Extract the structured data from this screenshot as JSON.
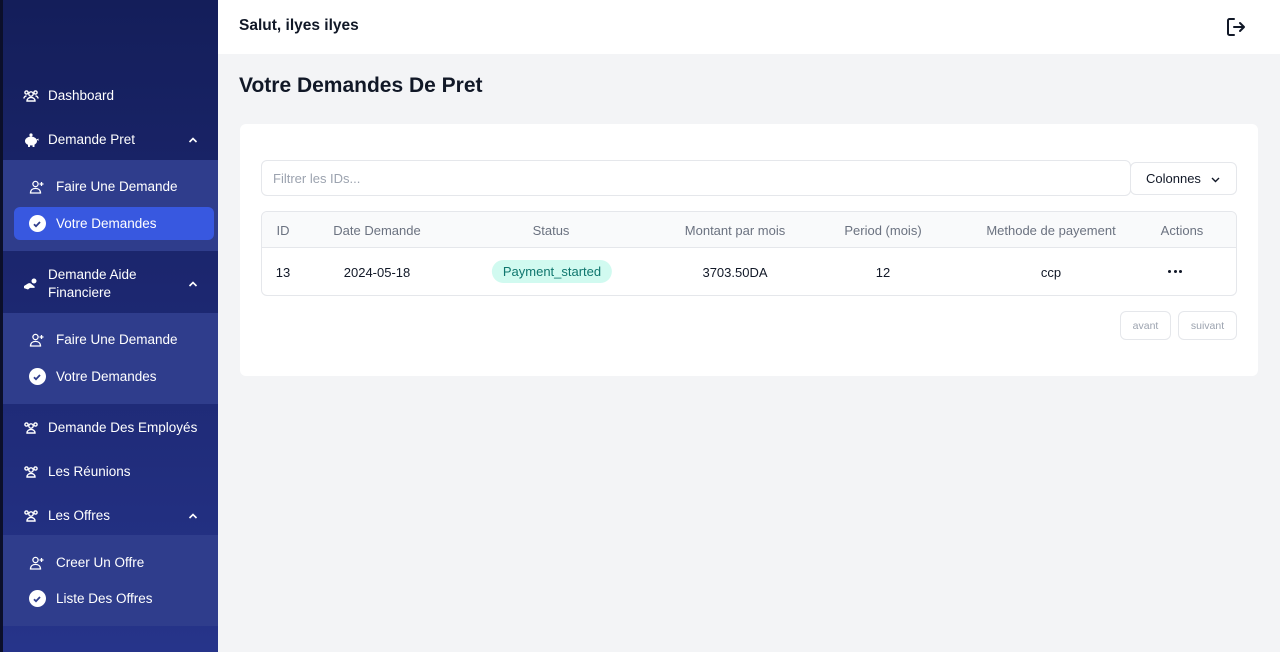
{
  "header": {
    "greeting": "Salut, ilyes ilyes",
    "logout_icon": "logout-icon"
  },
  "sidebar": {
    "dashboard": "Dashboard",
    "demande_pret": {
      "label": "Demande Pret",
      "items": [
        "Faire Une Demande",
        "Votre Demandes"
      ]
    },
    "demande_aide": {
      "label_line1": "Demande Aide",
      "label_line2": "Financiere",
      "items": [
        "Faire Une Demande",
        "Votre Demandes"
      ]
    },
    "demande_employes": "Demande Des Employés",
    "reunions": "Les Réunions",
    "offres": {
      "label": "Les Offres",
      "items": [
        "Creer Un Offre",
        "Liste Des Offres"
      ]
    },
    "colors": {
      "bg_top": "#141e5a",
      "bg_bottom": "#26348a",
      "submenu_bg": "#2f3d8c",
      "active": "#3858e0"
    }
  },
  "main": {
    "title": "Votre Demandes De Pret",
    "filter_placeholder": "Filtrer les IDs...",
    "columns_button": "Colonnes",
    "table": {
      "headers": [
        "ID",
        "Date Demande",
        "Status",
        "Montant par mois",
        "Period (mois)",
        "Methode de payement",
        "Actions"
      ],
      "rows": [
        {
          "id": "13",
          "date": "2024-05-18",
          "status": "Payment_started",
          "montant": "3703.50DA",
          "period": "12",
          "methode": "ccp"
        }
      ]
    },
    "pagination": {
      "prev": "avant",
      "next": "suivant"
    },
    "colors": {
      "status_bg": "#d1faf0",
      "status_text": "#0f766e"
    }
  }
}
